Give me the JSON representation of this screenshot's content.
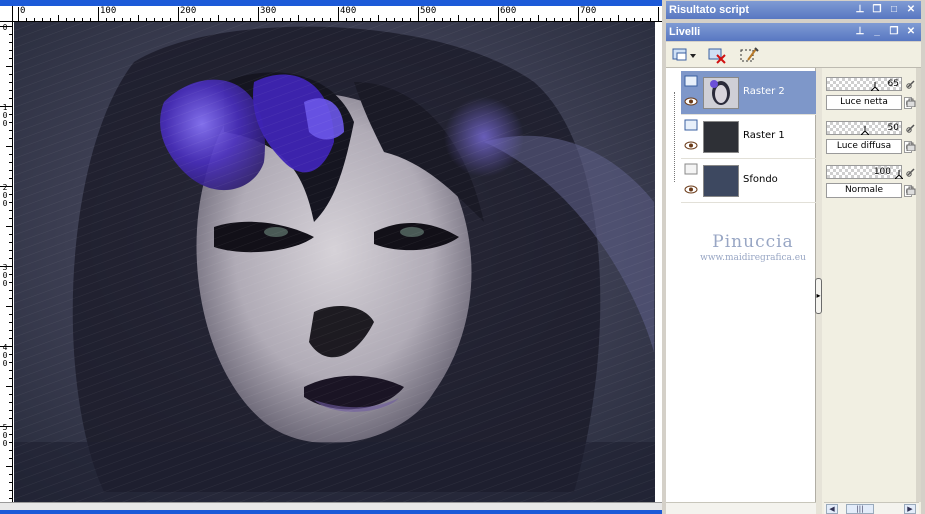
{
  "panels": {
    "script_output_title": "Risultato script",
    "layers_title": "Livelli"
  },
  "layers": [
    {
      "name": "Raster 2",
      "selected": true,
      "opacity": 65,
      "blend_mode": "Luce netta"
    },
    {
      "name": "Raster 1",
      "selected": false,
      "opacity": 50,
      "blend_mode": "Luce diffusa"
    },
    {
      "name": "Sfondo",
      "selected": false,
      "opacity": 100,
      "blend_mode": "Normale"
    }
  ],
  "watermark": {
    "name": "Pinuccia",
    "url": "www.maidiregrafica.eu"
  },
  "ruler": {
    "h_labels": [
      "0",
      "100",
      "200",
      "300",
      "400",
      "500",
      "600",
      "700"
    ],
    "v_labels": [
      "0",
      "1\n0\n0",
      "2\n0\n0",
      "3\n0\n0",
      "4\n0\n0",
      "5\n0\n0"
    ]
  },
  "colors": {
    "titlebar": "#5877c2",
    "selected_layer": "#7e97c9",
    "window_blue": "#1c5ad8",
    "artwork_purple": "#5a3fc4"
  }
}
